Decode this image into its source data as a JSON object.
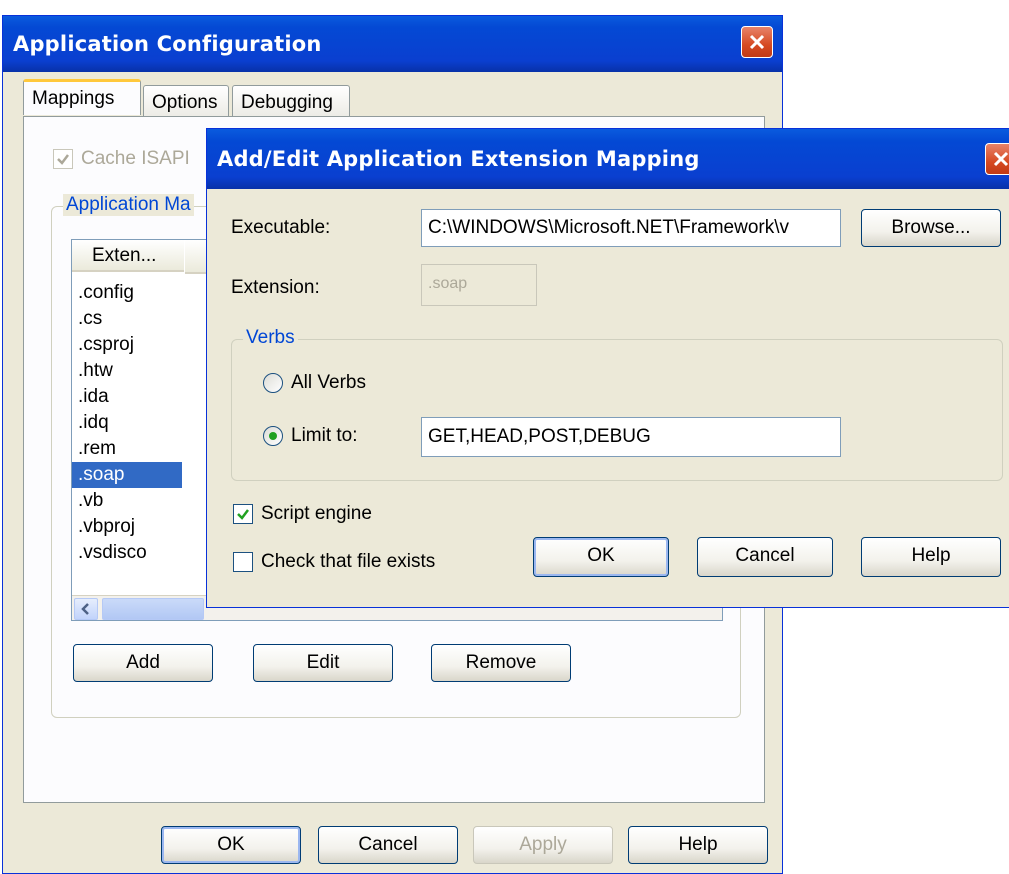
{
  "main_window": {
    "title": "Application Configuration",
    "tabs": [
      "Mappings",
      "Options",
      "Debugging"
    ],
    "cache_isapi_label": "Cache ISAPI",
    "group_label": "Application Ma",
    "list_header": "Exten...",
    "extensions": [
      ".config",
      ".cs",
      ".csproj",
      ".htw",
      ".ida",
      ".idq",
      ".rem",
      ".soap",
      ".vb",
      ".vbproj",
      ".vsdisco"
    ],
    "selected_extension": ".soap",
    "buttons": {
      "add": "Add",
      "edit": "Edit",
      "remove": "Remove",
      "ok": "OK",
      "cancel": "Cancel",
      "apply": "Apply",
      "help": "Help"
    }
  },
  "dialog": {
    "title": "Add/Edit Application Extension Mapping",
    "executable_label": "Executable:",
    "executable_value": "C:\\WINDOWS\\Microsoft.NET\\Framework\\v",
    "browse": "Browse...",
    "extension_label": "Extension:",
    "extension_value": ".soap",
    "verbs_group": "Verbs",
    "all_verbs": "All Verbs",
    "limit_to": "Limit to:",
    "limit_value": "GET,HEAD,POST,DEBUG",
    "selected_verb_option": "Limit to",
    "script_engine": "Script engine",
    "script_engine_checked": true,
    "check_file_exists": "Check that file exists",
    "check_file_exists_checked": false,
    "buttons": {
      "ok": "OK",
      "cancel": "Cancel",
      "help": "Help"
    }
  },
  "icons": [
    "close-icon",
    "checkmark-icon",
    "scroll-left-icon"
  ]
}
